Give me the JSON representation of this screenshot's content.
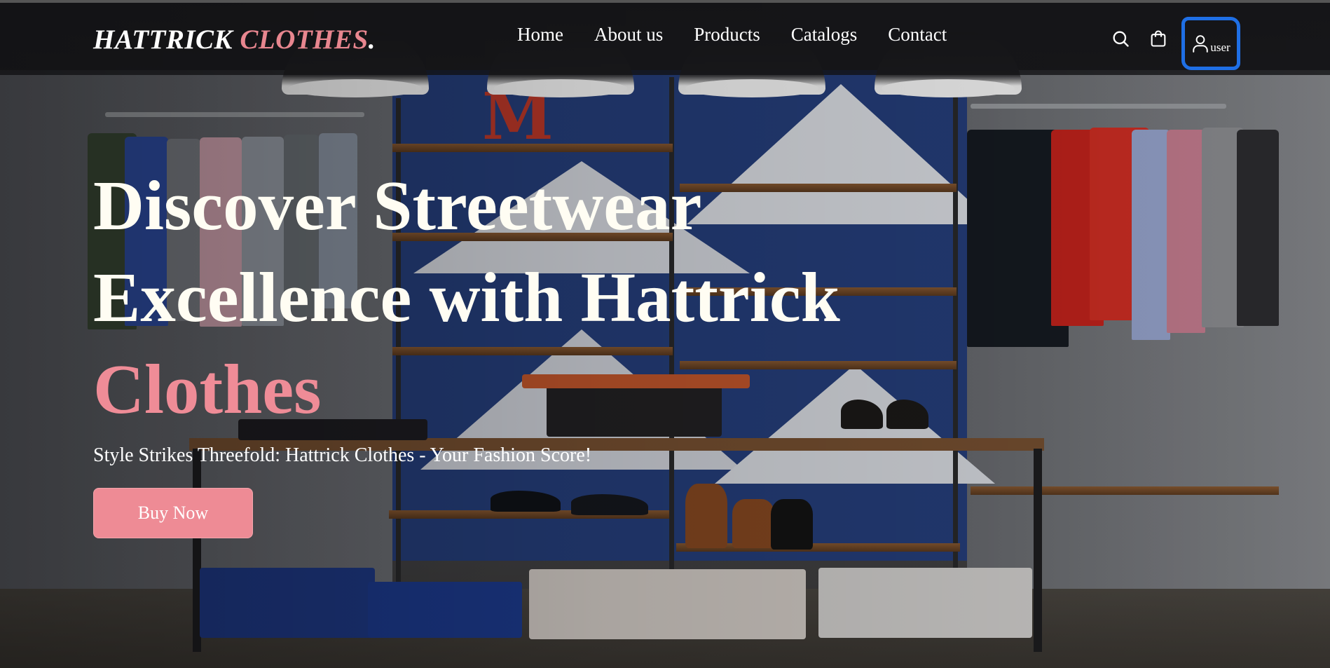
{
  "brand": {
    "name": "HATTRICK",
    "accent": "CLOTHES",
    "suffix": "."
  },
  "nav": {
    "items": [
      {
        "label": "Home"
      },
      {
        "label": "About us"
      },
      {
        "label": "Products"
      },
      {
        "label": "Catalogs"
      },
      {
        "label": "Contact"
      }
    ]
  },
  "actions": {
    "search_icon": "search-icon",
    "cart_icon": "shopping-bag-icon",
    "user_icon": "user-icon",
    "user_label": "user"
  },
  "hero": {
    "headline_line1": "Discover Streetwear",
    "headline_line2": "Excellence with Hattrick",
    "headline_accent": "Clothes",
    "tagline": "Style Strikes Threefold: Hattrick Clothes - Your Fashion Score!",
    "cta_label": "Buy Now",
    "background_letter": "M"
  },
  "colors": {
    "accent_pink": "#ee8b95",
    "headline_cream": "#fffdf3",
    "nav_bg": "#121214",
    "highlight_blue": "#1f6fe5"
  }
}
